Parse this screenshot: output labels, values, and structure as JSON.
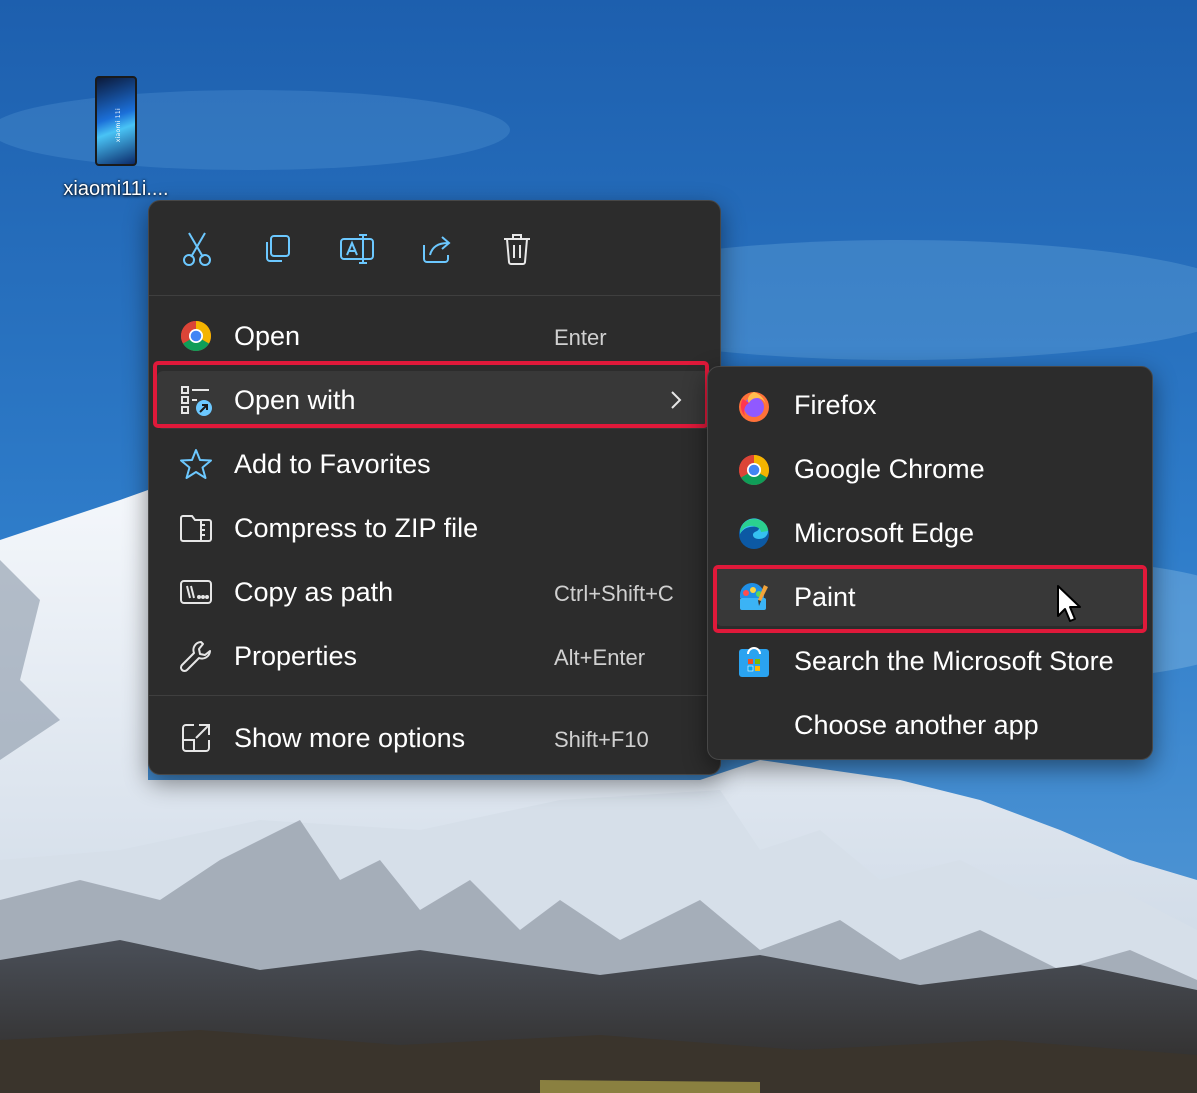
{
  "desktop": {
    "icon": {
      "label": "xiaomi11i....",
      "thumb_text": "xiaomi 11i"
    }
  },
  "context_menu": {
    "toolbar": [
      {
        "name": "cut-icon",
        "tooltip": "Cut"
      },
      {
        "name": "copy-icon",
        "tooltip": "Copy"
      },
      {
        "name": "rename-icon",
        "tooltip": "Rename"
      },
      {
        "name": "share-icon",
        "tooltip": "Share"
      },
      {
        "name": "delete-icon",
        "tooltip": "Delete"
      }
    ],
    "items": [
      {
        "label": "Open",
        "shortcut": "Enter",
        "icon": "chrome-icon"
      },
      {
        "label": "Open with",
        "shortcut": "",
        "icon": "open-with-icon",
        "submenu": true,
        "highlighted": true
      },
      {
        "label": "Add to Favorites",
        "shortcut": "",
        "icon": "star-icon"
      },
      {
        "label": "Compress to ZIP file",
        "shortcut": "",
        "icon": "zip-folder-icon"
      },
      {
        "label": "Copy as path",
        "shortcut": "Ctrl+Shift+C",
        "icon": "copy-path-icon"
      },
      {
        "label": "Properties",
        "shortcut": "Alt+Enter",
        "icon": "wrench-icon"
      },
      {
        "label": "Show more options",
        "shortcut": "Shift+F10",
        "icon": "show-more-icon"
      }
    ]
  },
  "open_with_submenu": {
    "items": [
      {
        "label": "Firefox",
        "icon": "firefox-icon"
      },
      {
        "label": "Google Chrome",
        "icon": "chrome-icon"
      },
      {
        "label": "Microsoft Edge",
        "icon": "edge-icon"
      },
      {
        "label": "Paint",
        "icon": "paint-icon",
        "highlighted": true
      },
      {
        "label": "Search the Microsoft Store",
        "icon": "store-icon"
      },
      {
        "label": "Choose another app",
        "icon": ""
      }
    ]
  },
  "colors": {
    "menu_bg": "#2c2c2c",
    "hover_bg": "#383838",
    "highlight_border": "#e0193a",
    "accent_icon": "#6cc8ff"
  }
}
